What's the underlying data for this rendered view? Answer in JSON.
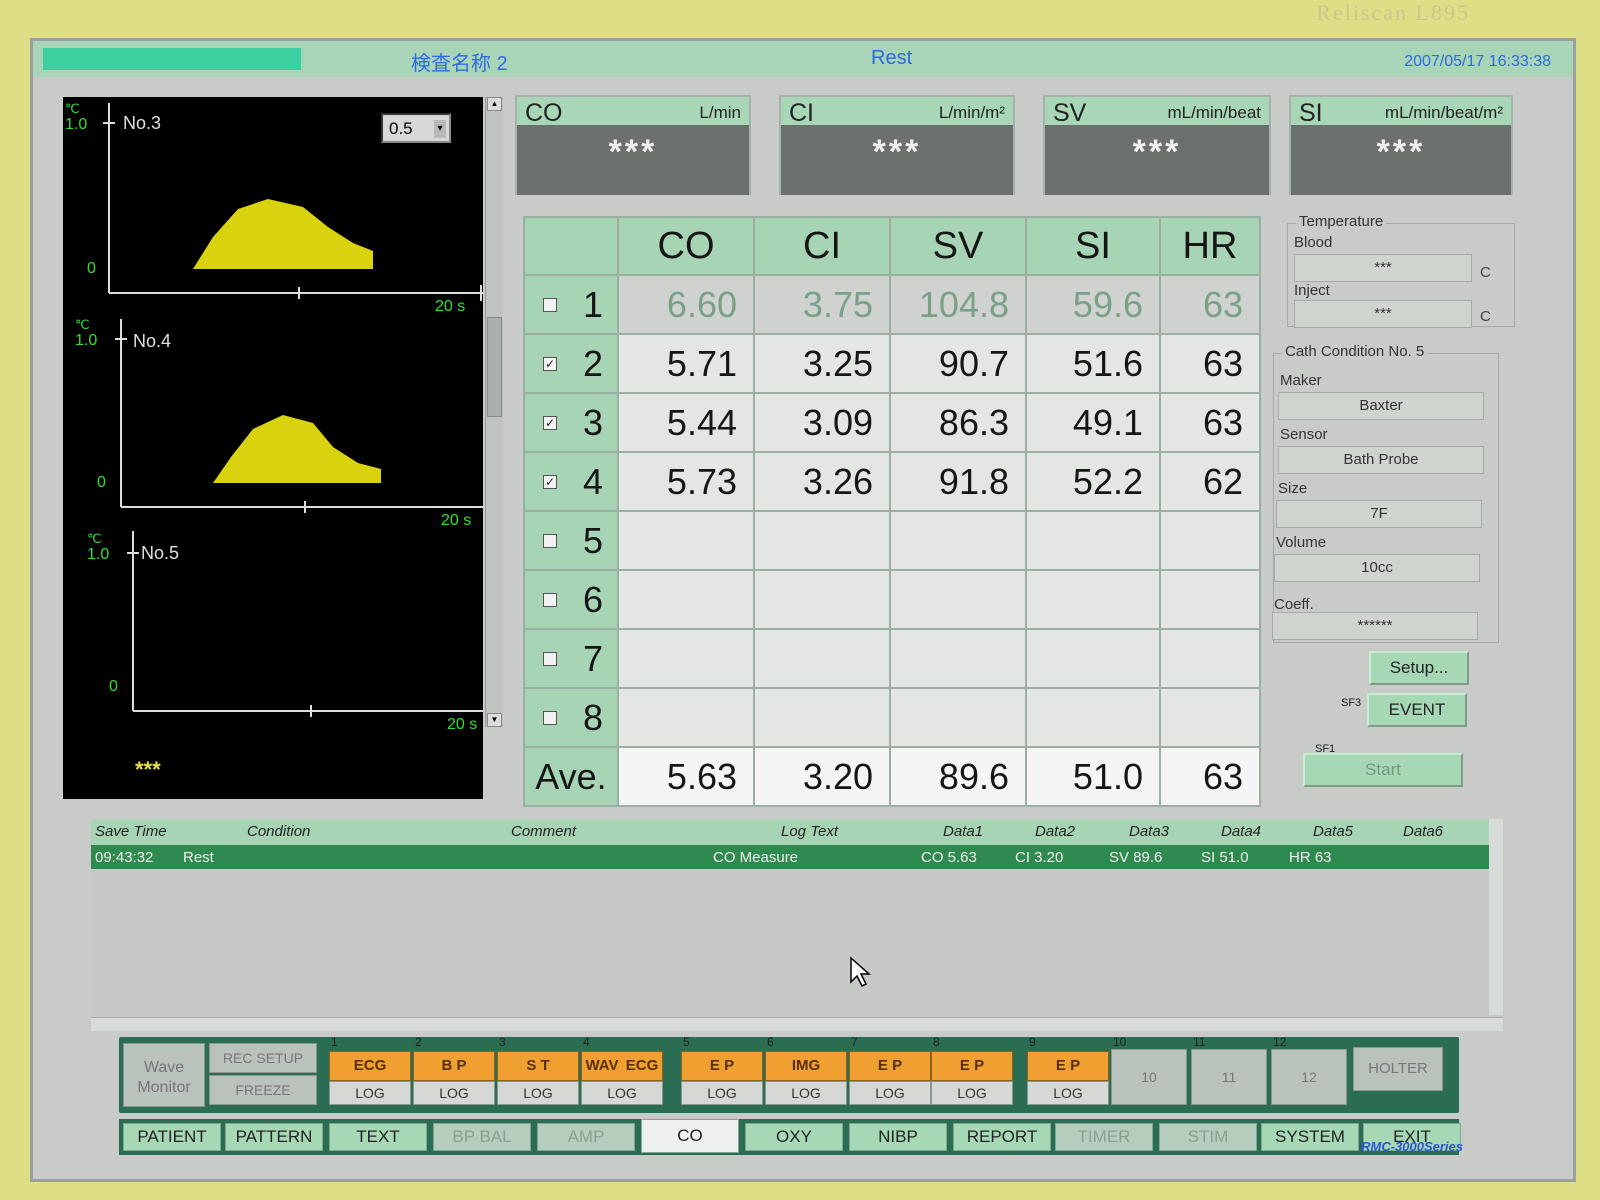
{
  "brand": "Reliscan L895",
  "titlebar": {
    "test_name": "検査名称 2",
    "condition": "Rest",
    "datetime": "2007/05/17  16:33:38"
  },
  "waveforms": {
    "scale_value": "0.5",
    "panels": [
      {
        "name": "No.3",
        "unit": "℃",
        "ymax": "1.0",
        "ymin": "0",
        "xmax": "20 s"
      },
      {
        "name": "No.4",
        "unit": "℃",
        "ymax": "1.0",
        "ymin": "0",
        "xmax": "20 s"
      },
      {
        "name": "No.5",
        "unit": "℃",
        "ymax": "1.0",
        "ymin": "0",
        "xmax": "20 s"
      }
    ],
    "bottom_value": "***"
  },
  "results": [
    {
      "name": "CO",
      "unit": "L/min",
      "value": "***"
    },
    {
      "name": "CI",
      "unit": "L/min/m²",
      "value": "***"
    },
    {
      "name": "SV",
      "unit": "mL/min/beat",
      "value": "***"
    },
    {
      "name": "SI",
      "unit": "mL/min/beat/m²",
      "value": "***"
    }
  ],
  "table": {
    "headers": [
      "CO",
      "CI",
      "SV",
      "SI",
      "HR"
    ],
    "rows": [
      {
        "n": "1",
        "checked": false,
        "vals": [
          "6.60",
          "3.75",
          "104.8",
          "59.6",
          "63"
        ]
      },
      {
        "n": "2",
        "checked": true,
        "vals": [
          "5.71",
          "3.25",
          "90.7",
          "51.6",
          "63"
        ]
      },
      {
        "n": "3",
        "checked": true,
        "vals": [
          "5.44",
          "3.09",
          "86.3",
          "49.1",
          "63"
        ]
      },
      {
        "n": "4",
        "checked": true,
        "vals": [
          "5.73",
          "3.26",
          "91.8",
          "52.2",
          "62"
        ]
      },
      {
        "n": "5",
        "checked": false,
        "vals": [
          "",
          "",
          "",
          "",
          ""
        ]
      },
      {
        "n": "6",
        "checked": false,
        "vals": [
          "",
          "",
          "",
          "",
          ""
        ]
      },
      {
        "n": "7",
        "checked": false,
        "vals": [
          "",
          "",
          "",
          "",
          ""
        ]
      },
      {
        "n": "8",
        "checked": false,
        "vals": [
          "",
          "",
          "",
          "",
          ""
        ]
      }
    ],
    "ave_label": "Ave.",
    "ave_vals": [
      "5.63",
      "3.20",
      "89.6",
      "51.0",
      "63"
    ]
  },
  "temperature": {
    "title": "Temperature",
    "blood_label": "Blood",
    "blood_value": "***",
    "inject_label": "Inject",
    "inject_value": "***",
    "unit": "C"
  },
  "cath": {
    "title": "Cath Condition No. 5",
    "maker_label": "Maker",
    "maker": "Baxter",
    "sensor_label": "Sensor",
    "sensor": "Bath Probe",
    "size_label": "Size",
    "size": "7F",
    "volume_label": "Volume",
    "volume": "10cc",
    "coeff_label": "Coeff.",
    "coeff": "******"
  },
  "buttons": {
    "setup": "Setup...",
    "event": "EVENT",
    "event_key": "SF3",
    "start": "Start",
    "start_key": "SF1"
  },
  "log": {
    "headers": [
      "Save Time",
      "Condition",
      "Comment",
      "Log Text",
      "Data1",
      "Data2",
      "Data3",
      "Data4",
      "Data5",
      "Data6"
    ],
    "row": {
      "time": "09:43:32",
      "condition": "Rest",
      "comment": "",
      "log_text": "CO  Measure",
      "data1": "CO  5.63",
      "data2": "CI  3.20",
      "data3": "SV  89.6",
      "data4": "SI  51.0",
      "data5": "HR  63",
      "data6": ""
    }
  },
  "toolbar": {
    "wave_monitor": "Wave Monitor",
    "rec_setup": "REC SETUP",
    "freeze": "FREEZE",
    "log_buttons": [
      {
        "num": "1",
        "top": "ECG",
        "bottom": "LOG"
      },
      {
        "num": "2",
        "top": "B P",
        "bottom": "LOG"
      },
      {
        "num": "3",
        "top": "S T",
        "bottom": "LOG"
      },
      {
        "num": "4",
        "top_left": "WAV",
        "top_right": "ECG",
        "bottom": "LOG"
      },
      {
        "num": "5",
        "top": "E P",
        "bottom": "LOG"
      },
      {
        "num": "6",
        "top": "IMG",
        "bottom": "LOG"
      },
      {
        "num": "7",
        "top": "E P",
        "bottom": "LOG"
      },
      {
        "num": "8",
        "top": "E P",
        "bottom": "LOG"
      },
      {
        "num": "9",
        "top": "E P",
        "bottom": "LOG"
      }
    ],
    "empty_buttons": [
      {
        "num": "10",
        "label": "10"
      },
      {
        "num": "11",
        "label": "11"
      },
      {
        "num": "12",
        "label": "12"
      }
    ],
    "holter": "HOLTER"
  },
  "tabs": [
    "PATIENT",
    "PATTERN",
    "TEXT",
    "BP BAL",
    "AMP",
    "CO",
    "OXY",
    "NIBP",
    "REPORT",
    "TIMER",
    "STIM",
    "SYSTEM",
    "EXIT"
  ],
  "series": "RMC-3000Series"
}
